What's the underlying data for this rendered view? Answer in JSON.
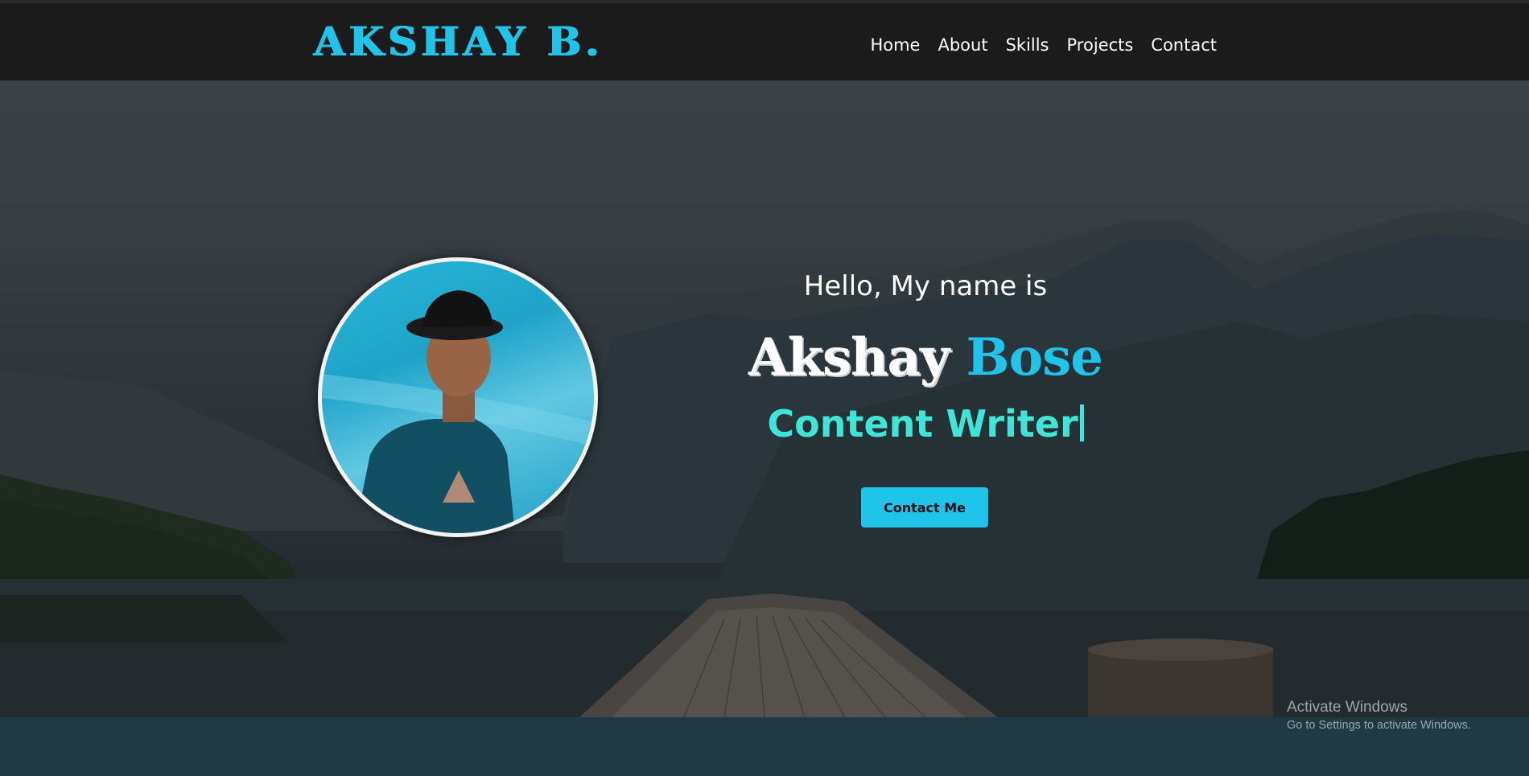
{
  "brand": {
    "text": "AKSHAY B."
  },
  "nav": {
    "items": [
      {
        "label": "Home"
      },
      {
        "label": "About"
      },
      {
        "label": "Skills"
      },
      {
        "label": "Projects"
      },
      {
        "label": "Contact"
      }
    ]
  },
  "hero": {
    "greeting": "Hello, My name is",
    "first_name": "Akshay",
    "last_name": "Bose",
    "role": "Content Writer",
    "cta_label": "Contact Me"
  },
  "watermark": {
    "title": "Activate Windows",
    "subtitle": "Go to Settings to activate Windows."
  },
  "colors": {
    "accent": "#1ec4ea",
    "role_text": "#3fe6d8",
    "navbar_bg": "#1b1b1b",
    "bottom_strip": "#1f3a45"
  }
}
